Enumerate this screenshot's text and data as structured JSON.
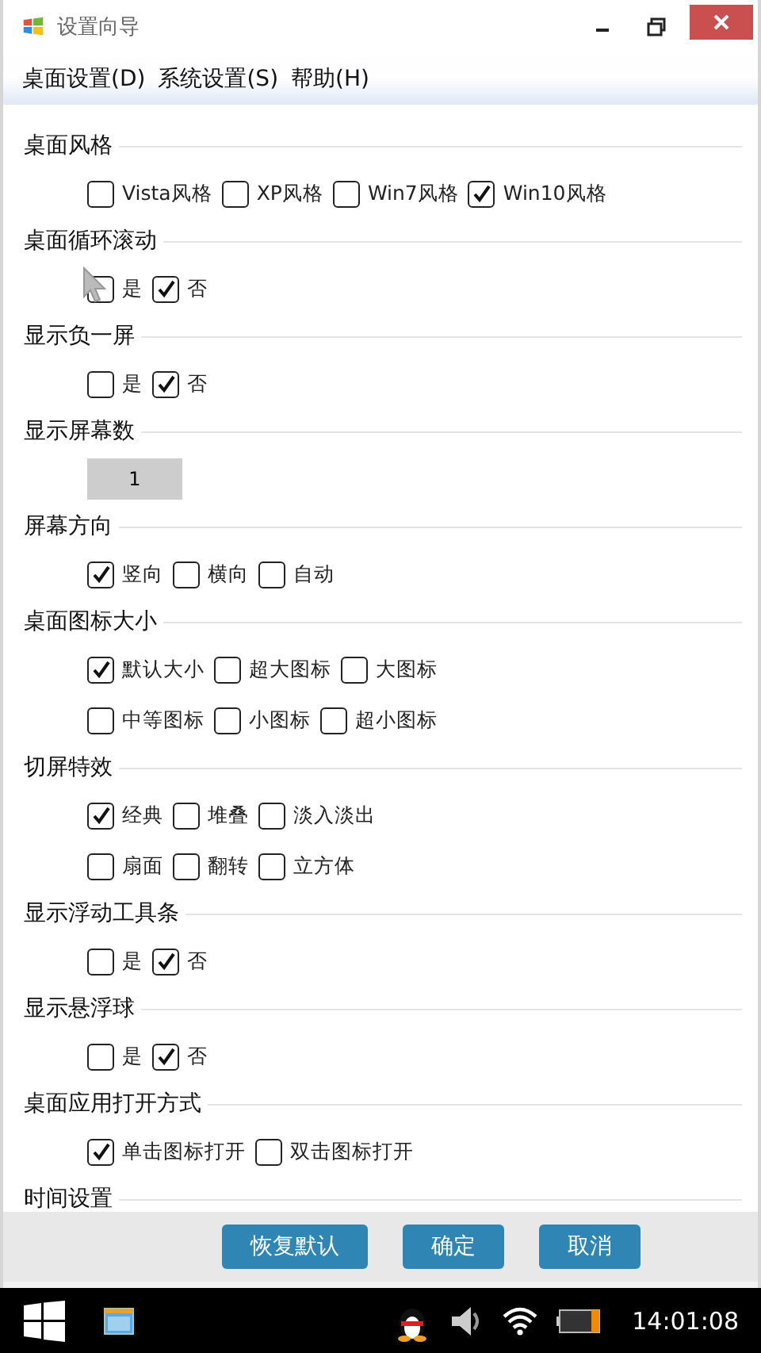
{
  "window": {
    "title": "设置向导"
  },
  "menu": [
    "桌面设置(D)",
    "系统设置(S)",
    "帮助(H)"
  ],
  "sections": [
    {
      "title": "桌面风格",
      "kind": "checks",
      "rows": [
        [
          {
            "label": "Vista风格",
            "checked": false
          },
          {
            "label": "XP风格",
            "checked": false
          },
          {
            "label": "Win7风格",
            "checked": false
          },
          {
            "label": "Win10风格",
            "checked": true
          }
        ]
      ]
    },
    {
      "title": "桌面循环滚动",
      "kind": "checks",
      "rows": [
        [
          {
            "label": "是",
            "checked": false
          },
          {
            "label": "否",
            "checked": true
          }
        ]
      ]
    },
    {
      "title": "显示负一屏",
      "kind": "checks",
      "rows": [
        [
          {
            "label": "是",
            "checked": false
          },
          {
            "label": "否",
            "checked": true
          }
        ]
      ]
    },
    {
      "title": "显示屏幕数",
      "kind": "value",
      "value": "1"
    },
    {
      "title": "屏幕方向",
      "kind": "checks",
      "rows": [
        [
          {
            "label": "竖向",
            "checked": true
          },
          {
            "label": "横向",
            "checked": false
          },
          {
            "label": "自动",
            "checked": false
          }
        ]
      ]
    },
    {
      "title": "桌面图标大小",
      "kind": "checks",
      "rows": [
        [
          {
            "label": "默认大小",
            "checked": true
          },
          {
            "label": "超大图标",
            "checked": false
          },
          {
            "label": "大图标",
            "checked": false
          }
        ],
        [
          {
            "label": "中等图标",
            "checked": false
          },
          {
            "label": "小图标",
            "checked": false
          },
          {
            "label": "超小图标",
            "checked": false
          }
        ]
      ]
    },
    {
      "title": "切屏特效",
      "kind": "checks",
      "rows": [
        [
          {
            "label": "经典",
            "checked": true
          },
          {
            "label": "堆叠",
            "checked": false
          },
          {
            "label": "淡入淡出",
            "checked": false
          }
        ],
        [
          {
            "label": "扇面",
            "checked": false
          },
          {
            "label": "翻转",
            "checked": false
          },
          {
            "label": "立方体",
            "checked": false
          }
        ]
      ]
    },
    {
      "title": "显示浮动工具条",
      "kind": "checks",
      "rows": [
        [
          {
            "label": "是",
            "checked": false
          },
          {
            "label": "否",
            "checked": true
          }
        ]
      ]
    },
    {
      "title": "显示悬浮球",
      "kind": "checks",
      "rows": [
        [
          {
            "label": "是",
            "checked": false
          },
          {
            "label": "否",
            "checked": true
          }
        ]
      ]
    },
    {
      "title": "桌面应用打开方式",
      "kind": "checks",
      "rows": [
        [
          {
            "label": "单击图标打开",
            "checked": true
          },
          {
            "label": "双击图标打开",
            "checked": false
          }
        ]
      ]
    },
    {
      "title": "时间设置",
      "kind": "header"
    }
  ],
  "buttons": [
    "恢复默认",
    "确定",
    "取消"
  ],
  "taskbar": {
    "time": "14:01:08"
  }
}
